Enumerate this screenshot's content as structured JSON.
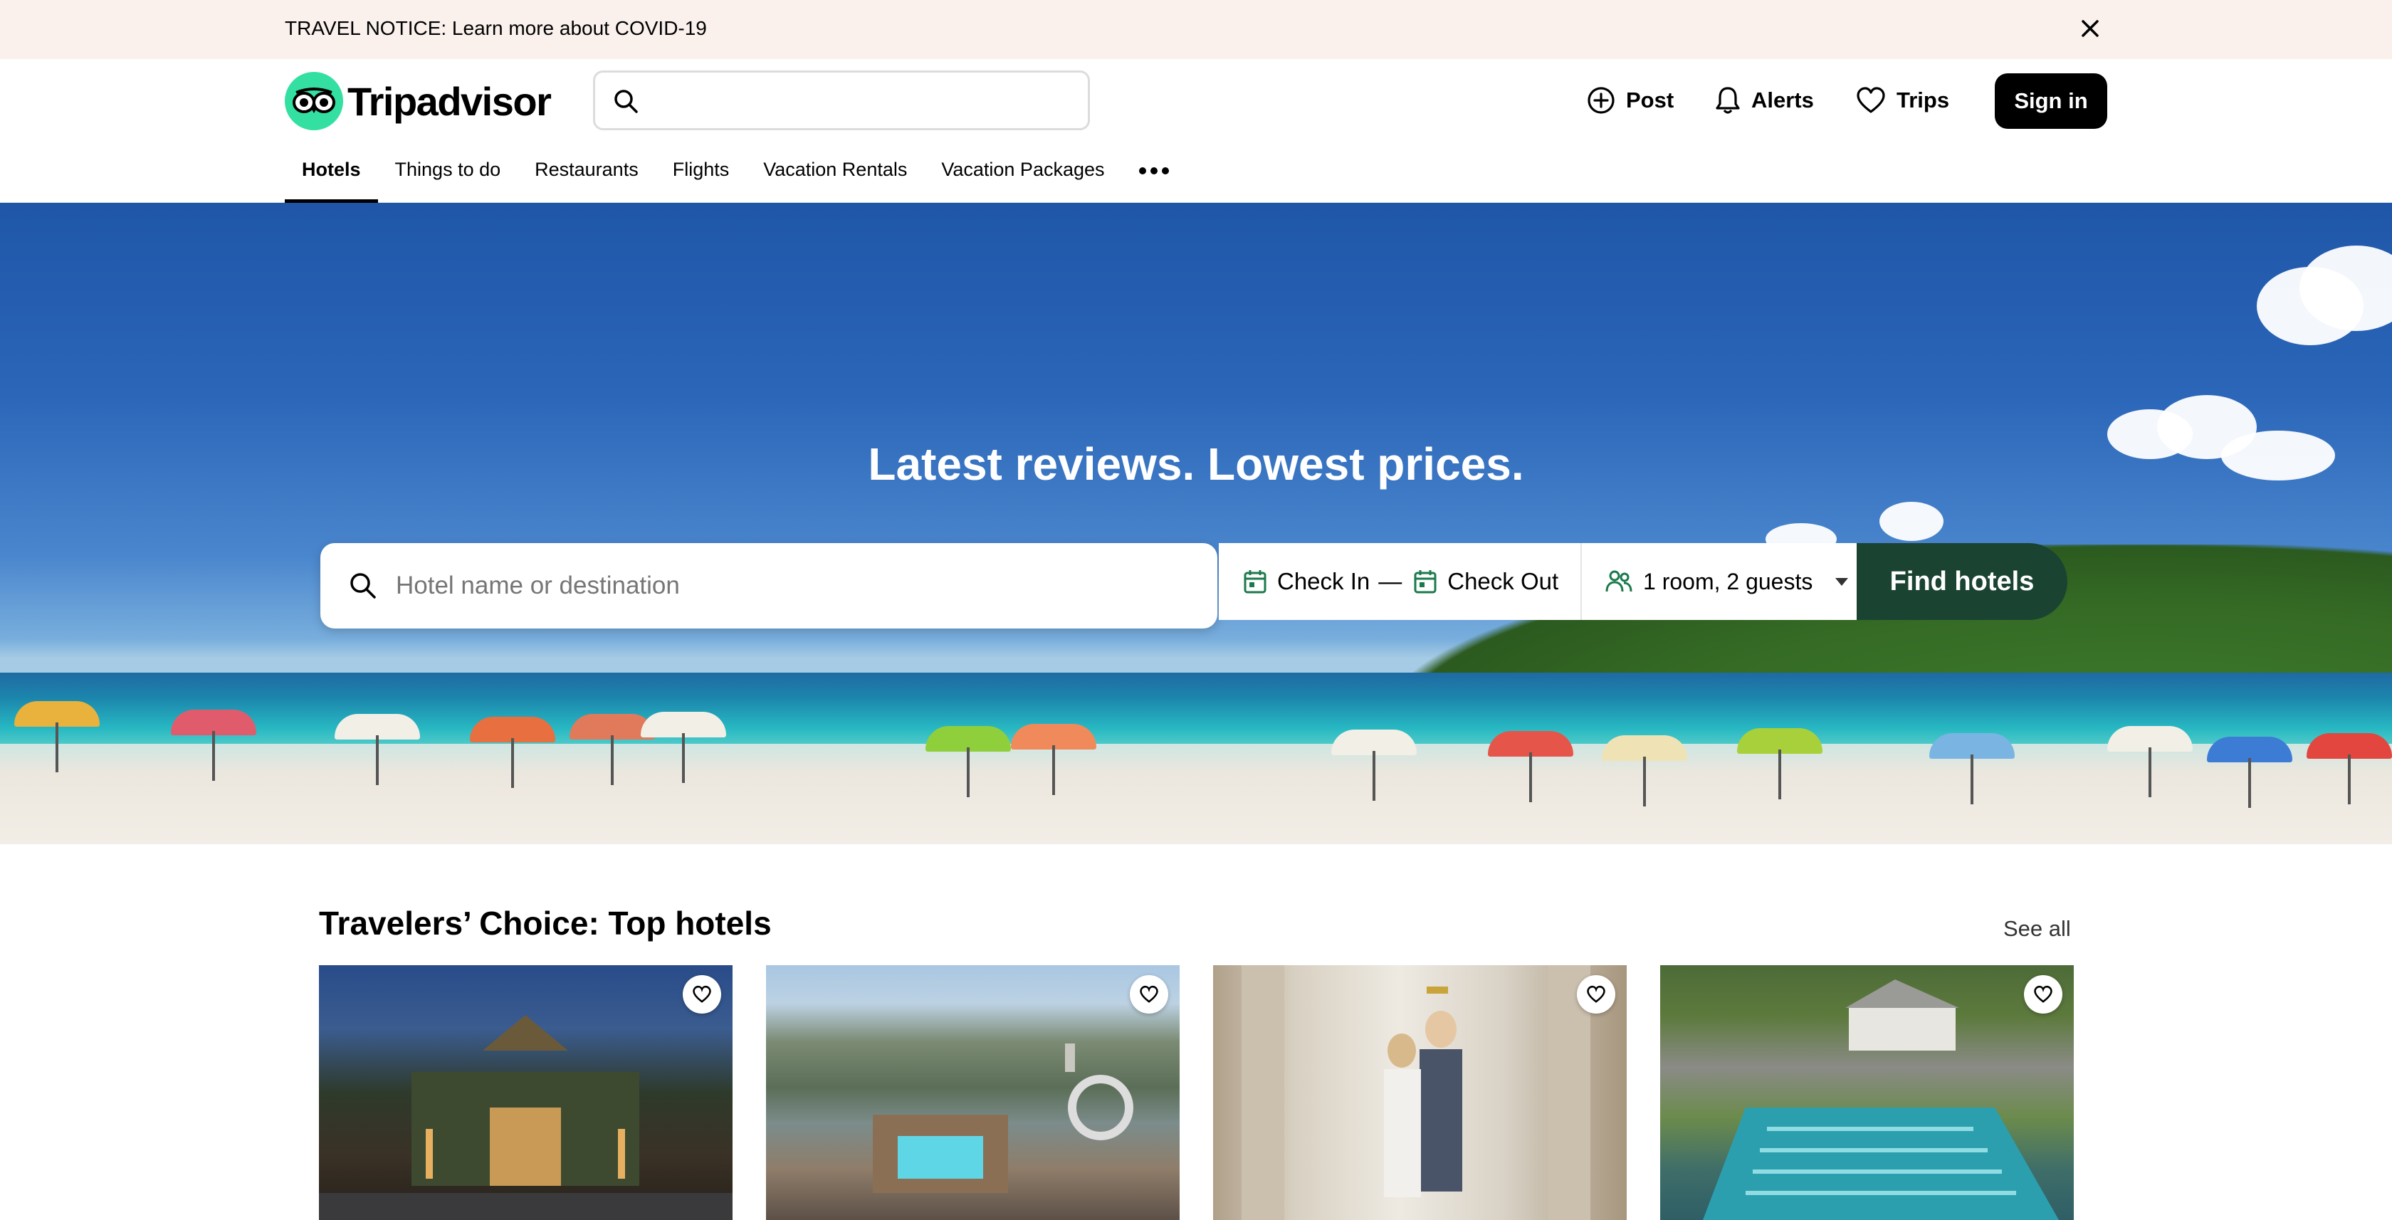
{
  "notice": {
    "text": "TRAVEL NOTICE: Learn more about COVID-19",
    "close_icon": "close-icon"
  },
  "header": {
    "logo_text": "Tripadvisor",
    "search_placeholder": "",
    "actions": {
      "post": "Post",
      "alerts": "Alerts",
      "trips": "Trips"
    },
    "sign_in": "Sign in"
  },
  "tabs": [
    {
      "label": "Hotels",
      "active": true
    },
    {
      "label": "Things to do",
      "active": false
    },
    {
      "label": "Restaurants",
      "active": false
    },
    {
      "label": "Flights",
      "active": false
    },
    {
      "label": "Vacation Rentals",
      "active": false
    },
    {
      "label": "Vacation Packages",
      "active": false
    }
  ],
  "hero": {
    "title": "Latest reviews. Lowest prices.",
    "destination_placeholder": "Hotel name or destination",
    "check_in": "Check In",
    "dash": "—",
    "check_out": "Check Out",
    "guests": "1 room, 2 guests",
    "find_button": "Find hotels"
  },
  "section": {
    "title": "Travelers’ Choice: Top hotels",
    "see_all": "See all"
  },
  "colors": {
    "brand_green": "#34e0a1",
    "find_button": "#1b4332",
    "notice_bg": "#faf1ed",
    "calendar_icon": "#1b7a4b"
  }
}
